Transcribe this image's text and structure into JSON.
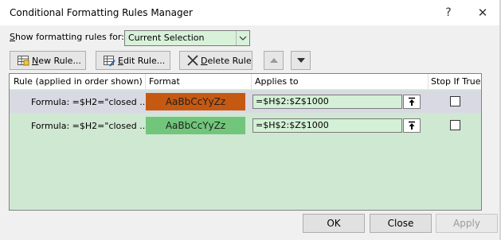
{
  "window": {
    "title": "Conditional Formatting Rules Manager",
    "help_glyph": "?",
    "close_glyph": "✕"
  },
  "show_rules": {
    "label_accel": "S",
    "label_rest": "how formatting rules for:",
    "selected": "Current Selection"
  },
  "toolbar": {
    "new_rule": {
      "accel": "N",
      "rest": "ew Rule..."
    },
    "edit_rule": {
      "accel": "E",
      "rest": "dit Rule..."
    },
    "delete_rule": {
      "accel": "D",
      "rest": "elete Rule"
    },
    "move_up_glyph": "▲",
    "move_down_glyph": "▼"
  },
  "table": {
    "headers": {
      "rule": "Rule (applied in order shown)",
      "format": "Format",
      "applies_to": "Applies to",
      "stop_if_true": "Stop If True"
    },
    "rows": [
      {
        "rule": "Formula: =$H2=\"closed ...",
        "format_preview": "AaBbCcYyZz",
        "format_fill": "#c65911",
        "format_text_color": "#1f1f1f",
        "applies_to": "=$H$2:$Z$1000",
        "stop_if_true": false,
        "selected": true
      },
      {
        "rule": "Formula: =$H2=\"closed ...",
        "format_preview": "AaBbCcYyZz",
        "format_fill": "#72c67b",
        "format_text_color": "#1f1f1f",
        "applies_to": "=$H$2:$Z$1000",
        "stop_if_true": false,
        "selected": false
      }
    ],
    "collapse_glyph": "⤒"
  },
  "buttons": {
    "ok": "OK",
    "close": "Close",
    "apply": "Apply"
  }
}
